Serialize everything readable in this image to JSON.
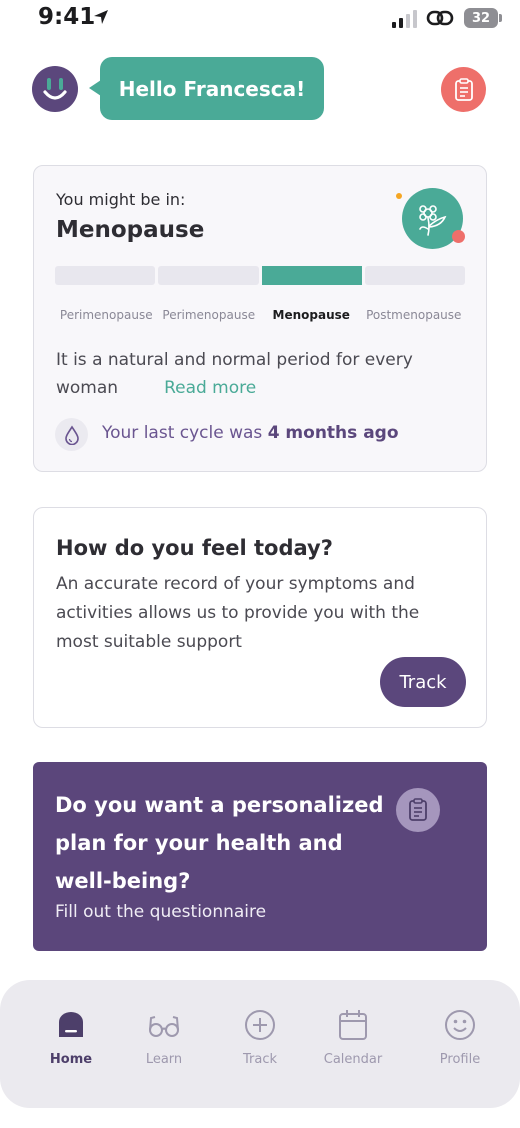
{
  "status_bar": {
    "time": "9:41",
    "battery": "32"
  },
  "header": {
    "greeting": "Hello Francesca!",
    "logo_icon": "smiley-logo-icon",
    "right_icon": "clipboard-icon"
  },
  "stage_card": {
    "lead": "You might be in:",
    "title": "Menopause",
    "icon": "flower-icon",
    "phases": [
      "Perimenopause",
      "Perimenopause",
      "Menopause",
      "Postmenopause"
    ],
    "active_phase_index": 2,
    "description": "It is a natural and normal period for every woman",
    "read_more": "Read more",
    "last_cycle_prefix": "Your last cycle was",
    "last_cycle_value": "4 months ago"
  },
  "feel_card": {
    "title": "How do you feel today?",
    "description": "An accurate record of your symptoms and activities allows us to provide you with the most suitable support",
    "button": "Track"
  },
  "questionnaire_card": {
    "title": "Do you want a personalized plan for your health and well-being?",
    "subtitle": "Fill out the questionnaire"
  },
  "bottom_nav": {
    "items": [
      {
        "label": "Home",
        "icon": "home-icon",
        "active": true
      },
      {
        "label": "Learn",
        "icon": "glasses-icon",
        "active": false
      },
      {
        "label": "Track",
        "icon": "plus-circle-icon",
        "active": false
      },
      {
        "label": "Calendar",
        "icon": "calendar-icon",
        "active": false
      },
      {
        "label": "Profile",
        "icon": "smiley-icon",
        "active": false
      }
    ]
  },
  "colors": {
    "primary_purple": "#5b477c",
    "teal": "#4aaa97",
    "coral": "#ee6f6a"
  }
}
